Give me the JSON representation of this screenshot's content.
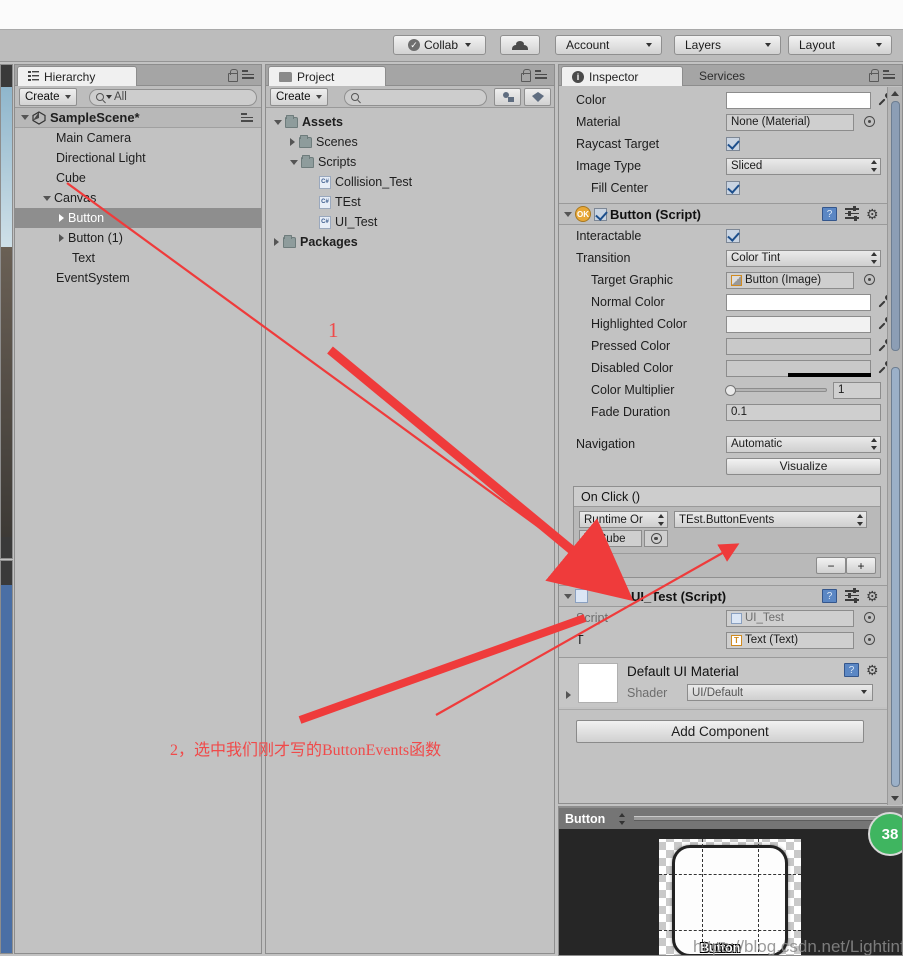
{
  "toolbar": {
    "collab_label": "Collab",
    "collab_icon": "check-circle-icon",
    "cloud_icon": "cloud-icon",
    "account_label": "Account",
    "layers_label": "Layers",
    "layout_label": "Layout"
  },
  "hierarchy": {
    "tab_label": "Hierarchy",
    "tab_icon": "hierarchy-icon",
    "create_label": "Create",
    "search_placeholder": "All",
    "scene_name": "SampleScene*",
    "items": [
      {
        "label": "Main Camera",
        "depth": 1,
        "arrow": "none",
        "selected": false
      },
      {
        "label": "Directional Light",
        "depth": 1,
        "arrow": "none",
        "selected": false
      },
      {
        "label": "Cube",
        "depth": 1,
        "arrow": "none",
        "selected": false
      },
      {
        "label": "Canvas",
        "depth": 1,
        "arrow": "open",
        "selected": false
      },
      {
        "label": "Button",
        "depth": 2,
        "arrow": "closed",
        "selected": true
      },
      {
        "label": "Button (1)",
        "depth": 2,
        "arrow": "closed",
        "selected": false
      },
      {
        "label": "Text",
        "depth": 2,
        "arrow": "none",
        "selected": false
      },
      {
        "label": "EventSystem",
        "depth": 1,
        "arrow": "none",
        "selected": false
      }
    ]
  },
  "project": {
    "tab_label": "Project",
    "tab_icon": "folder-icon",
    "create_label": "Create",
    "search_placeholder": "",
    "items": [
      {
        "label": "Assets",
        "depth": 0,
        "arrow": "open",
        "type": "folder",
        "bold": true
      },
      {
        "label": "Scenes",
        "depth": 1,
        "arrow": "closed",
        "type": "folder",
        "bold": false
      },
      {
        "label": "Scripts",
        "depth": 1,
        "arrow": "open",
        "type": "folder",
        "bold": false
      },
      {
        "label": "Collision_Test",
        "depth": 2,
        "arrow": "none",
        "type": "script",
        "bold": false
      },
      {
        "label": "TEst",
        "depth": 2,
        "arrow": "none",
        "type": "script",
        "bold": false
      },
      {
        "label": "UI_Test",
        "depth": 2,
        "arrow": "none",
        "type": "script",
        "bold": false
      },
      {
        "label": "Packages",
        "depth": 0,
        "arrow": "closed",
        "type": "folder",
        "bold": true
      }
    ]
  },
  "inspector": {
    "tab_label": "Inspector",
    "tab_icon": "info-icon",
    "services_tab_label": "Services",
    "image_component": {
      "color_label": "Color",
      "color_value": "#FFFFFF",
      "material_label": "Material",
      "material_value": "None (Material)",
      "raycast_label": "Raycast Target",
      "raycast_checked": true,
      "image_type_label": "Image Type",
      "image_type_value": "Sliced",
      "fill_center_label": "Fill Center",
      "fill_center_checked": true
    },
    "button_script": {
      "title": "Button (Script)",
      "enabled": true,
      "interactable_label": "Interactable",
      "interactable_checked": true,
      "transition_label": "Transition",
      "transition_value": "Color Tint",
      "target_graphic_label": "Target Graphic",
      "target_graphic_value": "Button (Image)",
      "normal_color_label": "Normal Color",
      "normal_color_value": "#FFFFFF",
      "highlighted_color_label": "Highlighted Color",
      "highlighted_color_value": "#F5F5F5",
      "pressed_color_label": "Pressed Color",
      "pressed_color_value": "#C8C8C8",
      "disabled_color_label": "Disabled Color",
      "disabled_color_value": "#C8C8C8",
      "color_multiplier_label": "Color Multiplier",
      "color_multiplier_value": "1",
      "fade_duration_label": "Fade Duration",
      "fade_duration_value": "0.1",
      "navigation_label": "Navigation",
      "navigation_value": "Automatic",
      "visualize_label": "Visualize"
    },
    "on_click": {
      "header": "On Click ()",
      "runtime_value": "Runtime Or",
      "function_value": "TEst.ButtonEvents",
      "object_value": "Cube",
      "add_label": "+",
      "remove_label": "−"
    },
    "ui_test_script": {
      "title": "UI_Test (Script)",
      "script_label": "Script",
      "script_value": "UI_Test",
      "t_label": "T",
      "t_value": "Text (Text)"
    },
    "material": {
      "title": "Default UI Material",
      "shader_label": "Shader",
      "shader_value": "UI/Default"
    },
    "add_component_label": "Add Component",
    "help_icon": "help-book-icon",
    "preset_icon": "preset-sliders-icon",
    "gear_icon": "gear-icon"
  },
  "preview": {
    "title": "Button",
    "sprite_label": "Button",
    "watermark": "https://blog.csdn.net/Lightinf",
    "badge_value": "38"
  },
  "annotations": {
    "label_1": "1",
    "label_2": "2，选中我们刚才写的ButtonEvents函数",
    "arrow_color": "#ef3b3b"
  }
}
